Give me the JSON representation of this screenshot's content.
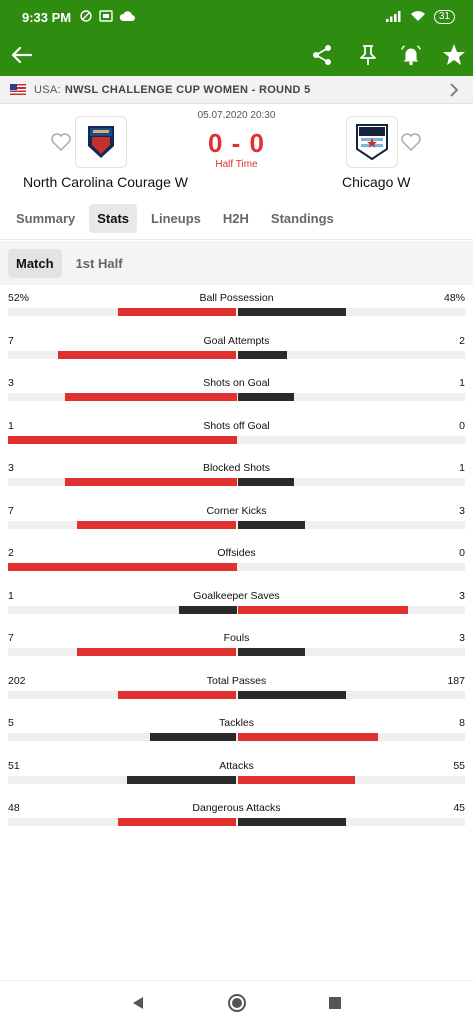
{
  "statusbar": {
    "time": "9:33 PM",
    "battery": "31"
  },
  "league": {
    "country": "USA:",
    "competition": "NWSL CHALLENGE CUP WOMEN - ROUND 5"
  },
  "match": {
    "datetime": "05.07.2020 20:30",
    "score": "0 - 0",
    "status": "Half Time",
    "home": {
      "name": "North Carolina Courage W",
      "crest_icon": "courage-crest-icon"
    },
    "away": {
      "name": "Chicago W",
      "crest_icon": "red-stars-crest-icon"
    }
  },
  "tabs": [
    "Summary",
    "Stats",
    "Lineups",
    "H2H",
    "Standings"
  ],
  "active_tab": "Stats",
  "subtabs": [
    "Match",
    "1st Half"
  ],
  "active_subtab": "Match",
  "colors": {
    "header": "#2e8c10",
    "accent": "#e03130",
    "dark": "#2a2a2a",
    "track": "#efefef"
  },
  "stats": [
    {
      "label": "Ball Possession",
      "home": "52%",
      "away": "48%",
      "home_share": 0.52,
      "away_share": 0.48,
      "leader": "home"
    },
    {
      "label": "Goal Attempts",
      "home": "7",
      "away": "2",
      "home_share": 0.78,
      "away_share": 0.22,
      "leader": "home"
    },
    {
      "label": "Shots on Goal",
      "home": "3",
      "away": "1",
      "home_share": 0.75,
      "away_share": 0.25,
      "leader": "home"
    },
    {
      "label": "Shots off Goal",
      "home": "1",
      "away": "0",
      "home_share": 1.0,
      "away_share": 0.0,
      "leader": "home"
    },
    {
      "label": "Blocked Shots",
      "home": "3",
      "away": "1",
      "home_share": 0.75,
      "away_share": 0.25,
      "leader": "home"
    },
    {
      "label": "Corner Kicks",
      "home": "7",
      "away": "3",
      "home_share": 0.7,
      "away_share": 0.3,
      "leader": "home"
    },
    {
      "label": "Offsides",
      "home": "2",
      "away": "0",
      "home_share": 1.0,
      "away_share": 0.0,
      "leader": "home"
    },
    {
      "label": "Goalkeeper Saves",
      "home": "1",
      "away": "3",
      "home_share": 0.25,
      "away_share": 0.75,
      "leader": "away"
    },
    {
      "label": "Fouls",
      "home": "7",
      "away": "3",
      "home_share": 0.7,
      "away_share": 0.3,
      "leader": "home"
    },
    {
      "label": "Total Passes",
      "home": "202",
      "away": "187",
      "home_share": 0.52,
      "away_share": 0.48,
      "leader": "home"
    },
    {
      "label": "Tackles",
      "home": "5",
      "away": "8",
      "home_share": 0.38,
      "away_share": 0.62,
      "leader": "away"
    },
    {
      "label": "Attacks",
      "home": "51",
      "away": "55",
      "home_share": 0.48,
      "away_share": 0.52,
      "leader": "away"
    },
    {
      "label": "Dangerous Attacks",
      "home": "48",
      "away": "45",
      "home_share": 0.52,
      "away_share": 0.48,
      "leader": "home"
    }
  ]
}
